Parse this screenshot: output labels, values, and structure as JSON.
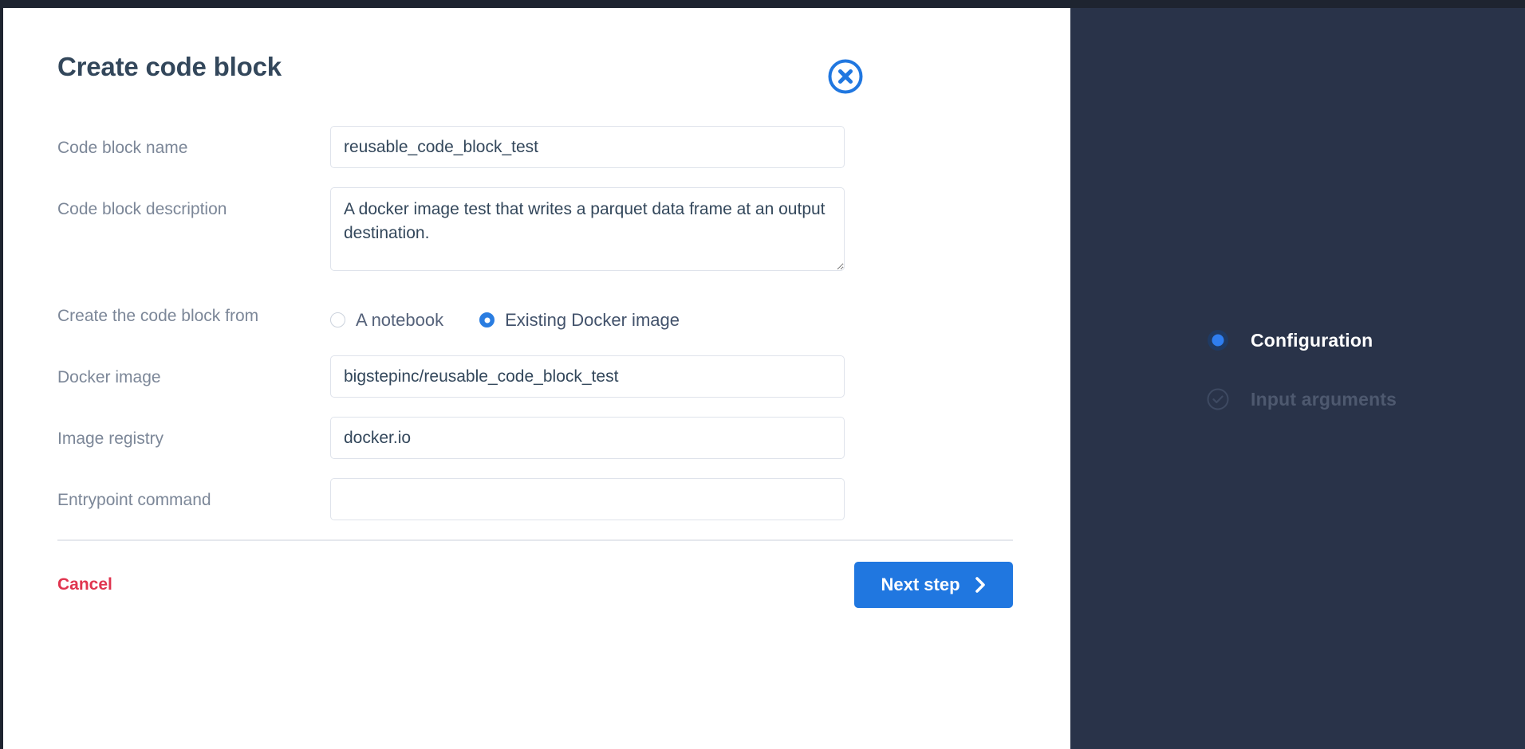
{
  "modal": {
    "title": "Create code block",
    "close_icon": "close-circle-icon",
    "fields": [
      {
        "label": "Code block name",
        "type": "text",
        "value": "reusable_code_block_test",
        "placeholder": ""
      },
      {
        "label": "Code block description",
        "type": "textarea",
        "value": "A docker image test that writes a parquet data frame at an output destination.",
        "placeholder": ""
      },
      {
        "label": "Create the code block from",
        "type": "radio",
        "options": [
          {
            "label": "A notebook",
            "selected": false
          },
          {
            "label": "Existing Docker image",
            "selected": true
          }
        ]
      },
      {
        "label": "Docker image",
        "type": "text",
        "value": "bigstepinc/reusable_code_block_test",
        "placeholder": ""
      },
      {
        "label": "Image registry",
        "type": "text",
        "value": "docker.io",
        "placeholder": ""
      },
      {
        "label": "Entrypoint command",
        "type": "text",
        "value": "",
        "placeholder": ""
      }
    ],
    "footer": {
      "cancel_label": "Cancel",
      "next_label": "Next step",
      "next_icon": "chevron-right-icon"
    }
  },
  "stepper": {
    "steps": [
      {
        "label": "Configuration",
        "state": "active",
        "icon": "radio-filled-icon"
      },
      {
        "label": "Input arguments",
        "state": "inactive",
        "icon": "check-circle-icon"
      }
    ]
  },
  "colors": {
    "accent_blue": "#2077e0",
    "danger_red": "#e0354f",
    "panel_dark": "#293349",
    "title_slate": "#33475b",
    "label_gray": "#7c8798"
  }
}
